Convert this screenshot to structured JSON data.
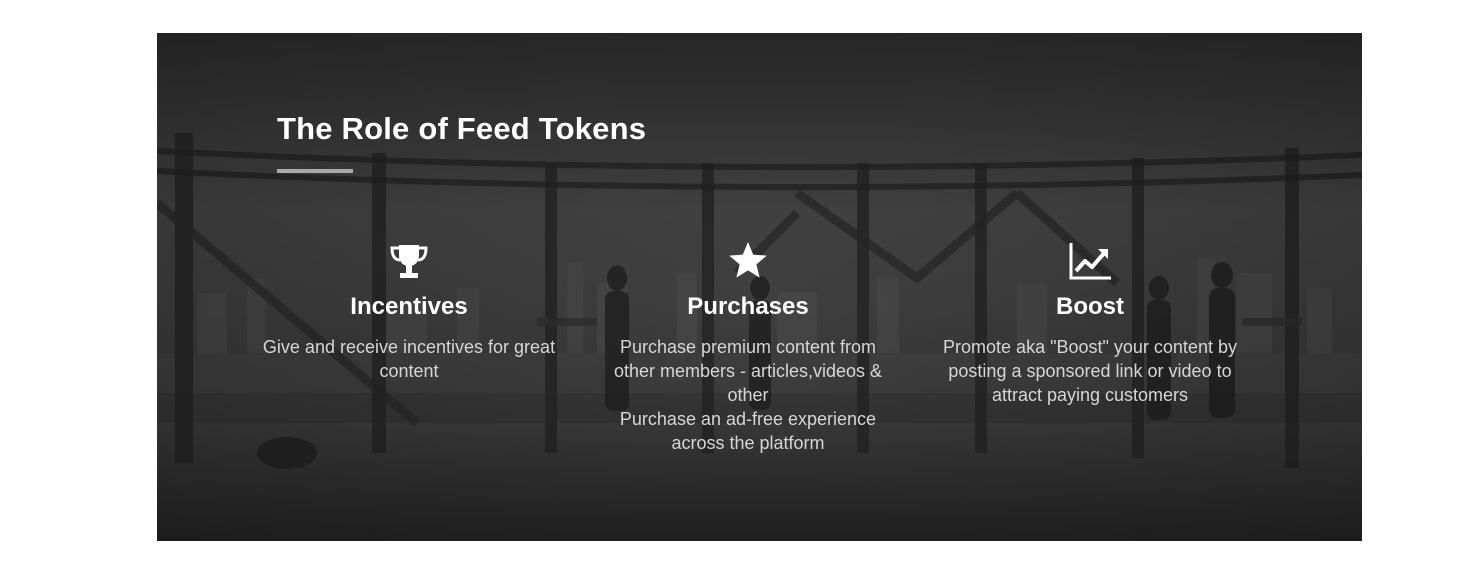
{
  "section": {
    "title": "The Role of Feed Tokens"
  },
  "features": [
    {
      "icon": "trophy-icon",
      "name": "Incentives",
      "description": "Give and receive incentives for great content"
    },
    {
      "icon": "star-icon",
      "name": "Purchases",
      "description": "Purchase premium content from other members - articles,videos & other\nPurchase an ad-free experience across the platform"
    },
    {
      "icon": "trending-up-chart-icon",
      "name": "Boost",
      "description": "Promote aka \"Boost\" your content by posting a sponsored link or video to attract paying customers"
    }
  ],
  "colors": {
    "title": "#ffffff",
    "description": "#d6d6d6",
    "underline": "#a9a9a9",
    "background_overlay": "#333333"
  }
}
